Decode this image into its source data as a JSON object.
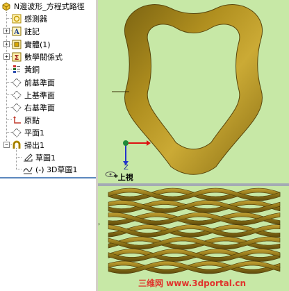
{
  "tree": {
    "root_label": "N邊波形_方程式路徑",
    "items": [
      {
        "label": "感測器",
        "icon": "sensor-icon"
      },
      {
        "label": "註記",
        "icon": "annotation-icon"
      },
      {
        "label": "實體(1)",
        "icon": "solid-bodies-icon"
      },
      {
        "label": "數學關係式",
        "icon": "equations-icon"
      },
      {
        "label": "黃銅",
        "icon": "material-icon"
      },
      {
        "label": "前基準面",
        "icon": "plane-icon"
      },
      {
        "label": "上基準面",
        "icon": "plane-icon"
      },
      {
        "label": "右基準面",
        "icon": "plane-icon"
      },
      {
        "label": "原點",
        "icon": "origin-icon"
      },
      {
        "label": "平面1",
        "icon": "plane-icon"
      },
      {
        "label": "掃出1",
        "icon": "sweep-icon"
      },
      {
        "label": "草圖1",
        "icon": "sketch-icon"
      },
      {
        "label": "(-) 3D草圖1",
        "icon": "3d-sketch-icon"
      }
    ]
  },
  "viewport": {
    "top_view_label": "*上視",
    "triad_y": "Z"
  },
  "watermark": "三维网 www.3dportal.cn",
  "colors": {
    "viewport_bg": "#c7e8a6",
    "part_gold": "#a08419",
    "part_highlight": "#c9a92c",
    "part_shadow": "#6b5510",
    "tree_border": "#4f76a8"
  }
}
